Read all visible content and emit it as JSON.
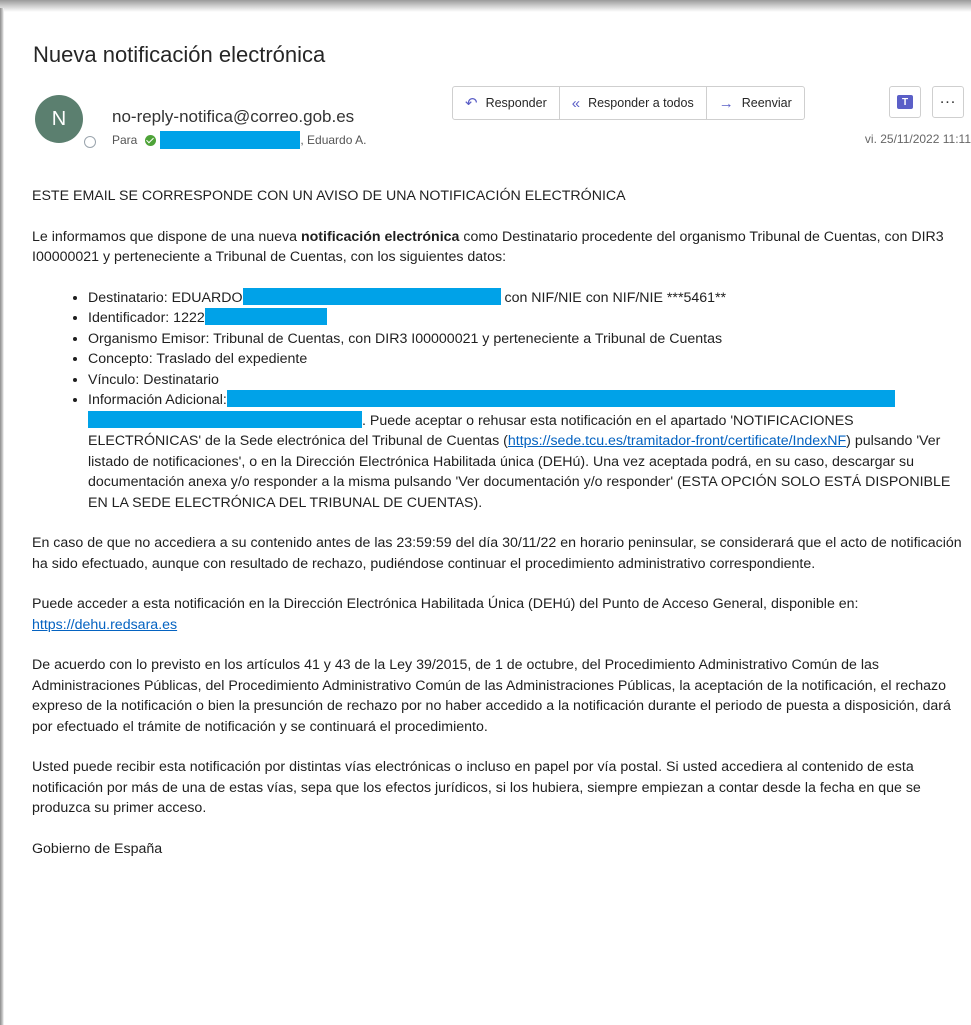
{
  "email": {
    "subject": "Nueva notificación electrónica",
    "avatar_initial": "N",
    "sender": "no-reply-notifica@correo.gob.es",
    "to_label": "Para",
    "recipient_visible": ", Eduardo A.",
    "date": "vi. 25/11/2022 11:11"
  },
  "toolbar": {
    "reply": "Responder",
    "reply_all": "Responder a todos",
    "forward": "Reenviar",
    "teams_icon": "teams-icon",
    "more_icon": "more-icon"
  },
  "body": {
    "heading": "ESTE EMAIL SE CORRESPONDE CON UN AVISO DE UNA NOTIFICACIÓN ELECTRÓNICA",
    "intro_pre": "Le informamos que dispone de una nueva ",
    "intro_bold": "notificación electrónica",
    "intro_post": " como Destinatario procedente del organismo Tribunal de Cuentas, con DIR3 I00000021 y perteneciente a Tribunal de Cuentas, con los siguientes datos:",
    "items": {
      "destinatario_pre": "Destinatario: EDUARDO",
      "destinatario_post": " con NIF/NIE con NIF/NIE ***5461**",
      "identificador": "Identificador: 1222",
      "organismo": "Organismo Emisor: Tribunal de Cuentas, con DIR3 I00000021 y perteneciente a Tribunal de Cuentas",
      "concepto": "Concepto: Traslado del expediente",
      "vinculo": "Vínculo: Destinatario",
      "info_label": "Información Adicional:",
      "info_text": ". Puede aceptar o rehusar esta notificación en el apartado 'NOTIFICACIONES ELECTRÓNICAS' de la Sede electrónica del Tribunal de Cuentas (",
      "info_link": "https://sede.tcu.es/tramitador-front/certificate/IndexNF",
      "info_text2": ") pulsando 'Ver listado de notificaciones', o en la Dirección Electrónica Habilitada única (DEHú). Una vez aceptada podrá, en su caso, descargar su documentación anexa y/o responder a la misma pulsando 'Ver documentación y/o responder' (ESTA OPCIÓN SOLO ESTÁ DISPONIBLE EN LA SEDE ELECTRÓNICA DEL TRIBUNAL DE CUENTAS)."
    },
    "para_deadline": "En caso de que no accediera a su contenido antes de las 23:59:59 del día 30/11/22 en horario peninsular, se considerará que el acto de notificación ha sido efectuado, aunque con resultado de rechazo, pudiéndose continuar el procedimiento administrativo correspondiente.",
    "para_dehu": "Puede acceder a esta notificación en la Dirección Electrónica Habilitada Única (DEHú) del Punto de Acceso General, disponible en: ",
    "dehu_link": "https://dehu.redsara.es",
    "para_law": "De acuerdo con lo previsto en los artículos 41 y 43 de la Ley 39/2015, de 1 de octubre, del Procedimiento Administrativo Común de las Administraciones Públicas, del Procedimiento Administrativo Común de las Administraciones Públicas, la aceptación de la notificación, el rechazo expreso de la notificación o bien la presunción de rechazo por no haber accedido a la notificación durante el periodo de puesta a disposición, dará por efectuado el trámite de notificación y se continuará el procedimiento.",
    "para_channels": "Usted puede recibir esta notificación por distintas vías electrónicas o incluso en papel por vía postal. Si usted accediera al contenido de esta notificación por más de una de estas vías, sepa que los efectos jurídicos, si los hubiera, siempre empiezan a contar desde la fecha en que se produzca su primer acceso.",
    "signature": "Gobierno de España"
  },
  "colors": {
    "redaction": "#00a2e8",
    "avatar": "#5b7f6f",
    "accent": "#5b5fc7",
    "link": "#0563c1"
  }
}
